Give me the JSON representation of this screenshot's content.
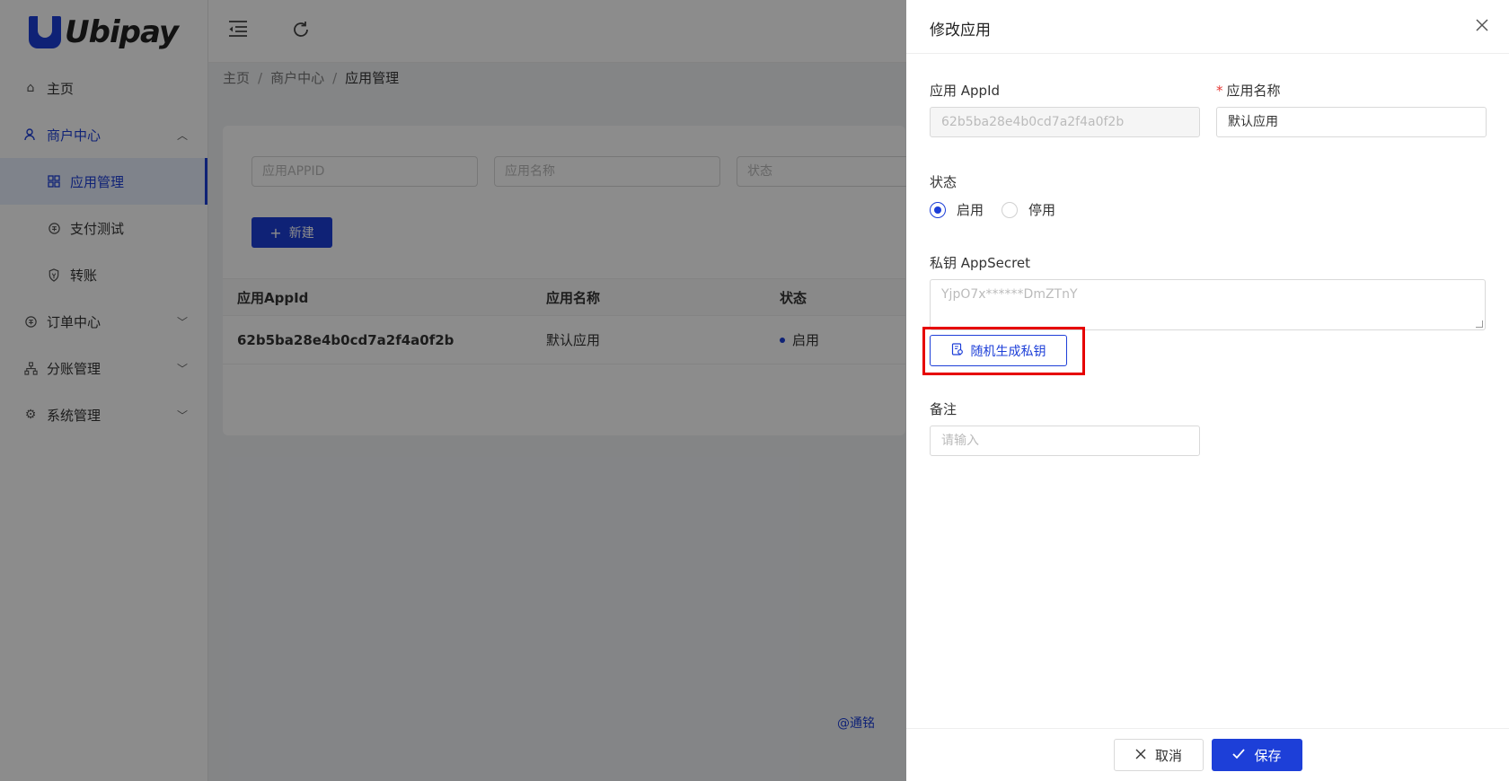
{
  "app": {
    "logo_text": "Ubipay"
  },
  "sidebar": {
    "items": [
      {
        "label": "主页",
        "icon": "home-icon"
      },
      {
        "label": "商户中心",
        "icon": "merchant-icon"
      },
      {
        "label": "应用管理",
        "icon": "grid-icon"
      },
      {
        "label": "支付测试",
        "icon": "payment-icon"
      },
      {
        "label": "转账",
        "icon": "transfer-icon"
      },
      {
        "label": "订单中心",
        "icon": "order-icon"
      },
      {
        "label": "分账管理",
        "icon": "split-icon"
      },
      {
        "label": "系统管理",
        "icon": "settings-icon"
      }
    ]
  },
  "breadcrumb": {
    "home": "主页",
    "parent": "商户中心",
    "current": "应用管理"
  },
  "filters": {
    "appid_placeholder": "应用APPID",
    "name_placeholder": "应用名称",
    "status_placeholder": "状态"
  },
  "toolbar": {
    "new_label": "新建"
  },
  "table": {
    "headers": {
      "appid": "应用AppId",
      "name": "应用名称",
      "status": "状态"
    },
    "rows": [
      {
        "appid": "62b5ba28e4b0cd7a2f4a0f2b",
        "name": "默认应用",
        "status": "启用"
      }
    ]
  },
  "footer": {
    "author": "@通铭"
  },
  "drawer": {
    "title": "修改应用",
    "appid_label": "应用 AppId",
    "appid_value": "62b5ba28e4b0cd7a2f4a0f2b",
    "name_label": "应用名称",
    "name_value": "默认应用",
    "status_label": "状态",
    "status_enabled": "启用",
    "status_disabled": "停用",
    "secret_label": "私钥 AppSecret",
    "secret_value": "YjpO7x******DmZTnY",
    "generate_label": "随机生成私钥",
    "remark_label": "备注",
    "remark_placeholder": "请输入",
    "cancel_label": "取消",
    "save_label": "保存"
  },
  "colors": {
    "primary": "#1d3fd8",
    "highlight": "#e60000",
    "required": "#e53935"
  }
}
